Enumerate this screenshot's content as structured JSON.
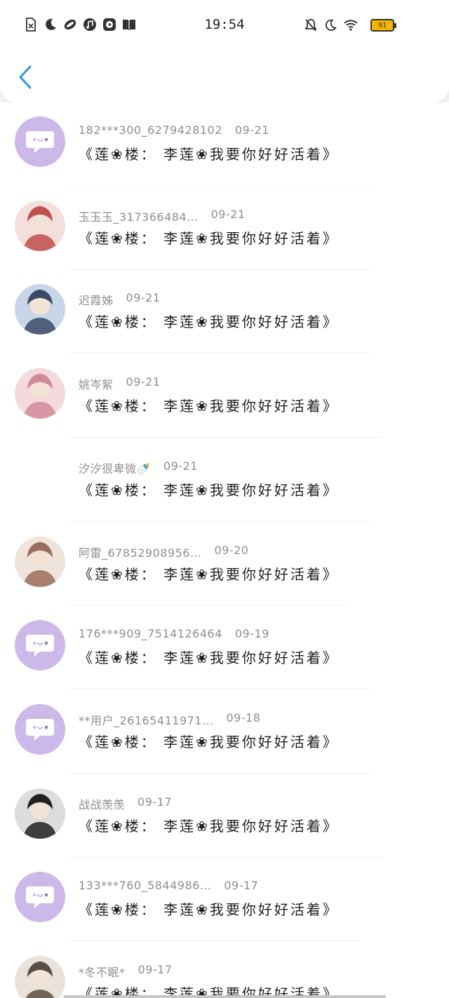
{
  "status_bar": {
    "time": "19:54",
    "battery": "91",
    "left_icons": [
      "sim-off-icon",
      "moon-icon",
      "app-icon",
      "music-icon",
      "play-icon",
      "book-icon"
    ],
    "right_icons": [
      "bell-off-icon",
      "moon-icon",
      "wifi-icon",
      "battery-icon"
    ]
  },
  "header": {
    "back_icon": "chevron-left-icon",
    "accent": "#2f95e8"
  },
  "comments": [
    {
      "user": "182***300_6279428102",
      "date": "09-21",
      "text": "《莲❀楼： 李莲❀我要你好好活着》",
      "avatar": "default"
    },
    {
      "user": "玉玉玉_317366484…",
      "date": "09-21",
      "text": "《莲❀楼： 李莲❀我要你好好活着》",
      "avatar": "photo"
    },
    {
      "user": "迟霞姊",
      "date": "09-21",
      "text": "《莲❀楼： 李莲❀我要你好好活着》",
      "avatar": "photo"
    },
    {
      "user": "姚岑絮",
      "date": "09-21",
      "text": "《莲❀楼： 李莲❀我要你好好活着》",
      "avatar": "photo"
    },
    {
      "user": "汐汐很卑微🍼",
      "date": "09-21",
      "text": "《莲❀楼： 李莲❀我要你好好活着》",
      "avatar": "none"
    },
    {
      "user": "阿雷_67852908956…",
      "date": "09-20",
      "text": "《莲❀楼： 李莲❀我要你好好活着》",
      "avatar": "photo"
    },
    {
      "user": "176***909_7514126464",
      "date": "09-19",
      "text": "《莲❀楼： 李莲❀我要你好好活着》",
      "avatar": "default"
    },
    {
      "user": "**用户_26165411971…",
      "date": "09-18",
      "text": "《莲❀楼： 李莲❀我要你好好活着》",
      "avatar": "default"
    },
    {
      "user": "战战羡羡",
      "date": "09-17",
      "text": "《莲❀楼： 李莲❀我要你好好活着》",
      "avatar": "photo"
    },
    {
      "user": "133***760_5844986…",
      "date": "09-17",
      "text": "《莲❀楼： 李莲❀我要你好好活着》",
      "avatar": "default"
    },
    {
      "user": "*冬不眠*",
      "date": "09-17",
      "text": "《莲❀楼： 李莲❀我要你好好活着》",
      "avatar": "photo"
    }
  ]
}
